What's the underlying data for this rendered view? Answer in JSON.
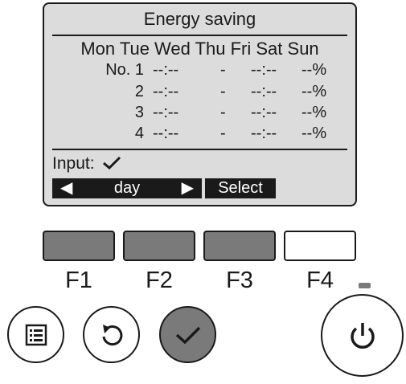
{
  "screen": {
    "title": "Energy saving",
    "days": "Mon Tue Wed Thu Fri Sat Sun",
    "rows": [
      {
        "label": "No. 1",
        "start": "--:--",
        "sep": "-",
        "end": "--:--",
        "percent": "--%"
      },
      {
        "label": "2",
        "start": "--:--",
        "sep": "-",
        "end": "--:--",
        "percent": "--%"
      },
      {
        "label": "3",
        "start": "--:--",
        "sep": "-",
        "end": "--:--",
        "percent": "--%"
      },
      {
        "label": "4",
        "start": "--:--",
        "sep": "-",
        "end": "--:--",
        "percent": "--%"
      }
    ],
    "input_label": "Input:",
    "softkeys": {
      "left_arrow": "◀",
      "day": "day",
      "right_arrow": "▶",
      "select": "Select"
    }
  },
  "function_keys": [
    "F1",
    "F2",
    "F3",
    "F4"
  ],
  "buttons": {
    "menu_icon": "menu-icon",
    "return_icon": "return-icon",
    "confirm_icon": "check-icon",
    "power_icon": "power-icon"
  },
  "colors": {
    "lcd_background": "#dcdcdc",
    "button_gray": "#7a7a7a",
    "ink": "#1a1a1a"
  }
}
